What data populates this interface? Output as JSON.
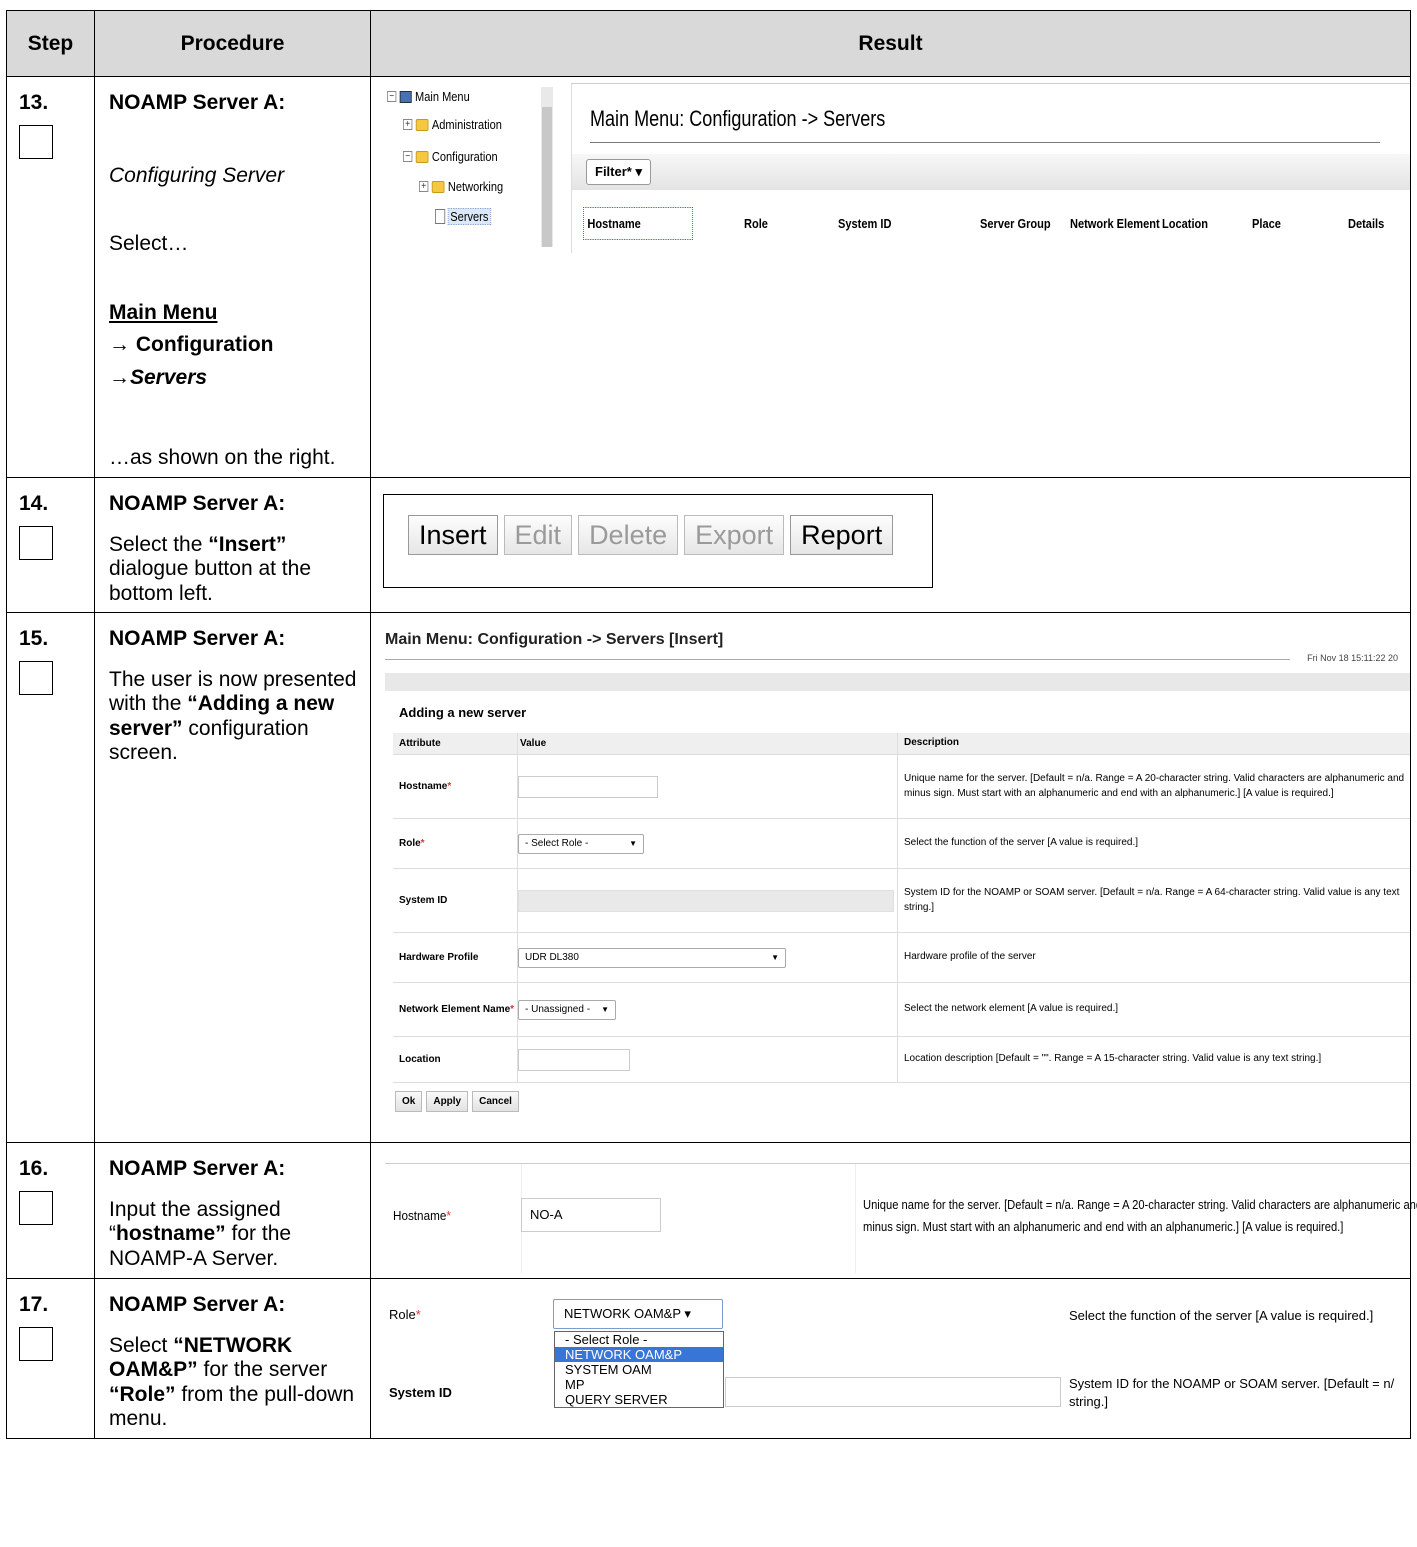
{
  "headers": {
    "step": "Step",
    "procedure": "Procedure",
    "result": "Result"
  },
  "steps": [
    {
      "num": "13.",
      "server": "NOAMP Server A:",
      "subtitle": "Configuring Server",
      "select": "Select…",
      "menu1": "Main Menu",
      "menu2": "→ Configuration",
      "menu3": "→Servers",
      "shown": "…as shown on the right."
    },
    {
      "num": "14.",
      "server": "NOAMP Server A:",
      "text_a": "Select the ",
      "text_b": "“Insert”",
      "text_c": " dialogue button at the bottom left."
    },
    {
      "num": "15.",
      "server": "NOAMP Server A:",
      "text_a": "The user is now presented with the ",
      "text_b": "“Adding a new server”",
      "text_c": " configuration screen."
    },
    {
      "num": "16.",
      "server": "NOAMP Server A:",
      "text_a": "Input the assigned “",
      "text_b": "hostname”",
      "text_c": " for the NOAMP-A Server."
    },
    {
      "num": "17.",
      "server": "NOAMP Server A:",
      "text_a": "Select ",
      "text_b": "“NETWORK OAM&P”",
      "text_c": " for the server ",
      "text_d": "“Role”",
      "text_e": " from the pull-down menu."
    }
  ],
  "shot13": {
    "tree": [
      "Main Menu",
      "Administration",
      "Configuration",
      "Networking",
      "Servers"
    ],
    "title": "Main Menu: Configuration -> Servers",
    "filter": "Filter* ▾",
    "columns": [
      "Hostname",
      "Role",
      "System ID",
      "Server Group",
      "Network Element",
      "Location",
      "Place",
      "Details"
    ]
  },
  "shot14": {
    "buttons": [
      "Insert",
      "Edit",
      "Delete",
      "Export",
      "Report"
    ]
  },
  "shot15": {
    "title": "Main Menu: Configuration -> Servers [Insert]",
    "date": "Fri Nov 18 15:11:22 20",
    "subtitle": "Adding a new server",
    "col_attr": "Attribute",
    "col_value": "Value",
    "col_desc": "Description",
    "rows": [
      {
        "attr": "Hostname",
        "req": "*",
        "desc": "Unique name for the server. [Default = n/a. Range = A 20-character string. Valid characters are alphanumeric and minus sign. Must start with an alphanumeric and end with an alphanumeric.] [A value is required.]"
      },
      {
        "attr": "Role",
        "req": "*",
        "value": "- Select Role -",
        "desc": "Select the function of the server [A value is required.]"
      },
      {
        "attr": "System ID",
        "req": "",
        "desc": "System ID for the NOAMP or SOAM server. [Default = n/a. Range = A 64-character string. Valid value is any text string.]"
      },
      {
        "attr": "Hardware Profile",
        "req": "",
        "value": "UDR DL380",
        "desc": "Hardware profile of the server"
      },
      {
        "attr": "Network Element Name",
        "req": "*",
        "value": "- Unassigned -",
        "desc": "Select the network element [A value is required.]"
      },
      {
        "attr": "Location",
        "req": "",
        "desc": "Location description [Default = \"\". Range = A 15-character string. Valid value is any text string.]"
      }
    ],
    "buttons": [
      "Ok",
      "Apply",
      "Cancel"
    ]
  },
  "shot16": {
    "label": "Hostname",
    "req": "*",
    "value": "NO-A",
    "desc1": "Unique name for the server. [Default = n/a. Range = A 20-character string. Valid characters are alphanumeric and",
    "desc2": "minus sign. Must start with an alphanumeric and end with an alphanumeric.] [A value is required.]"
  },
  "shot17": {
    "role_label": "Role",
    "req": "*",
    "selected": "NETWORK OAM&P  ▾",
    "options": [
      "- Select Role -",
      "NETWORK OAM&P",
      "SYSTEM OAM",
      "MP",
      "QUERY SERVER"
    ],
    "role_desc": "Select the function of the server [A value is required.]",
    "sysid_label": "System ID",
    "sysid_desc1": "System ID for the NOAMP or SOAM server. [Default = n/",
    "sysid_desc2": "string.]"
  }
}
